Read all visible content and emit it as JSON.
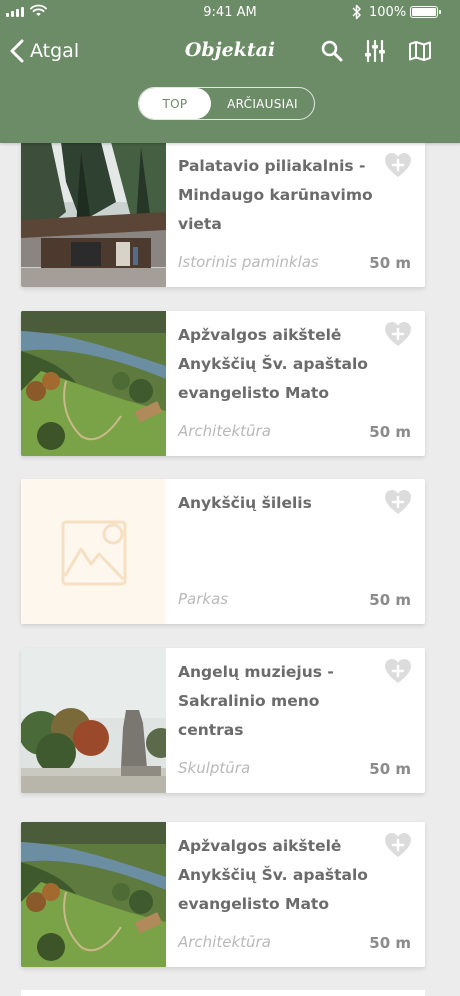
{
  "status_bar": {
    "time": "9:41 AM",
    "battery": "100%"
  },
  "nav": {
    "back_label": "Atgal",
    "title": "Objektai",
    "icons": [
      "search-icon",
      "filter-sliders-icon",
      "map-icon"
    ]
  },
  "segments": [
    {
      "label": "TOP",
      "active": true
    },
    {
      "label": "ARČIAUSIAI",
      "active": false
    }
  ],
  "items": [
    {
      "name_lines": [
        "Palatavio piliakalnis -",
        "Mindaugo karūnavimo",
        "vieta"
      ],
      "category": "Istorinis paminklas",
      "distance": "50 m",
      "image": "forest-pavilion-photo"
    },
    {
      "name_lines": [
        "Apžvalgos aikštelė",
        "Anykščių Šv. apaštalo",
        "evangelisto Mato"
      ],
      "category": "Architektūra",
      "distance": "50 m",
      "image": "aerial-river-photo"
    },
    {
      "name_lines": [
        "Anykščių šilelis"
      ],
      "category": "Parkas",
      "distance": "50 m",
      "image": "placeholder-image-icon"
    },
    {
      "name_lines": [
        "Angelų muziejus -",
        "Sakralinio meno centras"
      ],
      "category": "Skulptūra",
      "distance": "50 m",
      "image": "statue-photo"
    },
    {
      "name_lines": [
        "Apžvalgos aikštelė",
        "Anykščių Šv. apaštalo",
        "evangelisto Mato"
      ],
      "category": "Architektūra",
      "distance": "50 m",
      "image": "aerial-river-photo"
    }
  ],
  "colors": {
    "header": "#6c8b67",
    "background": "#ececec",
    "placeholder": "#fdf7ee"
  }
}
